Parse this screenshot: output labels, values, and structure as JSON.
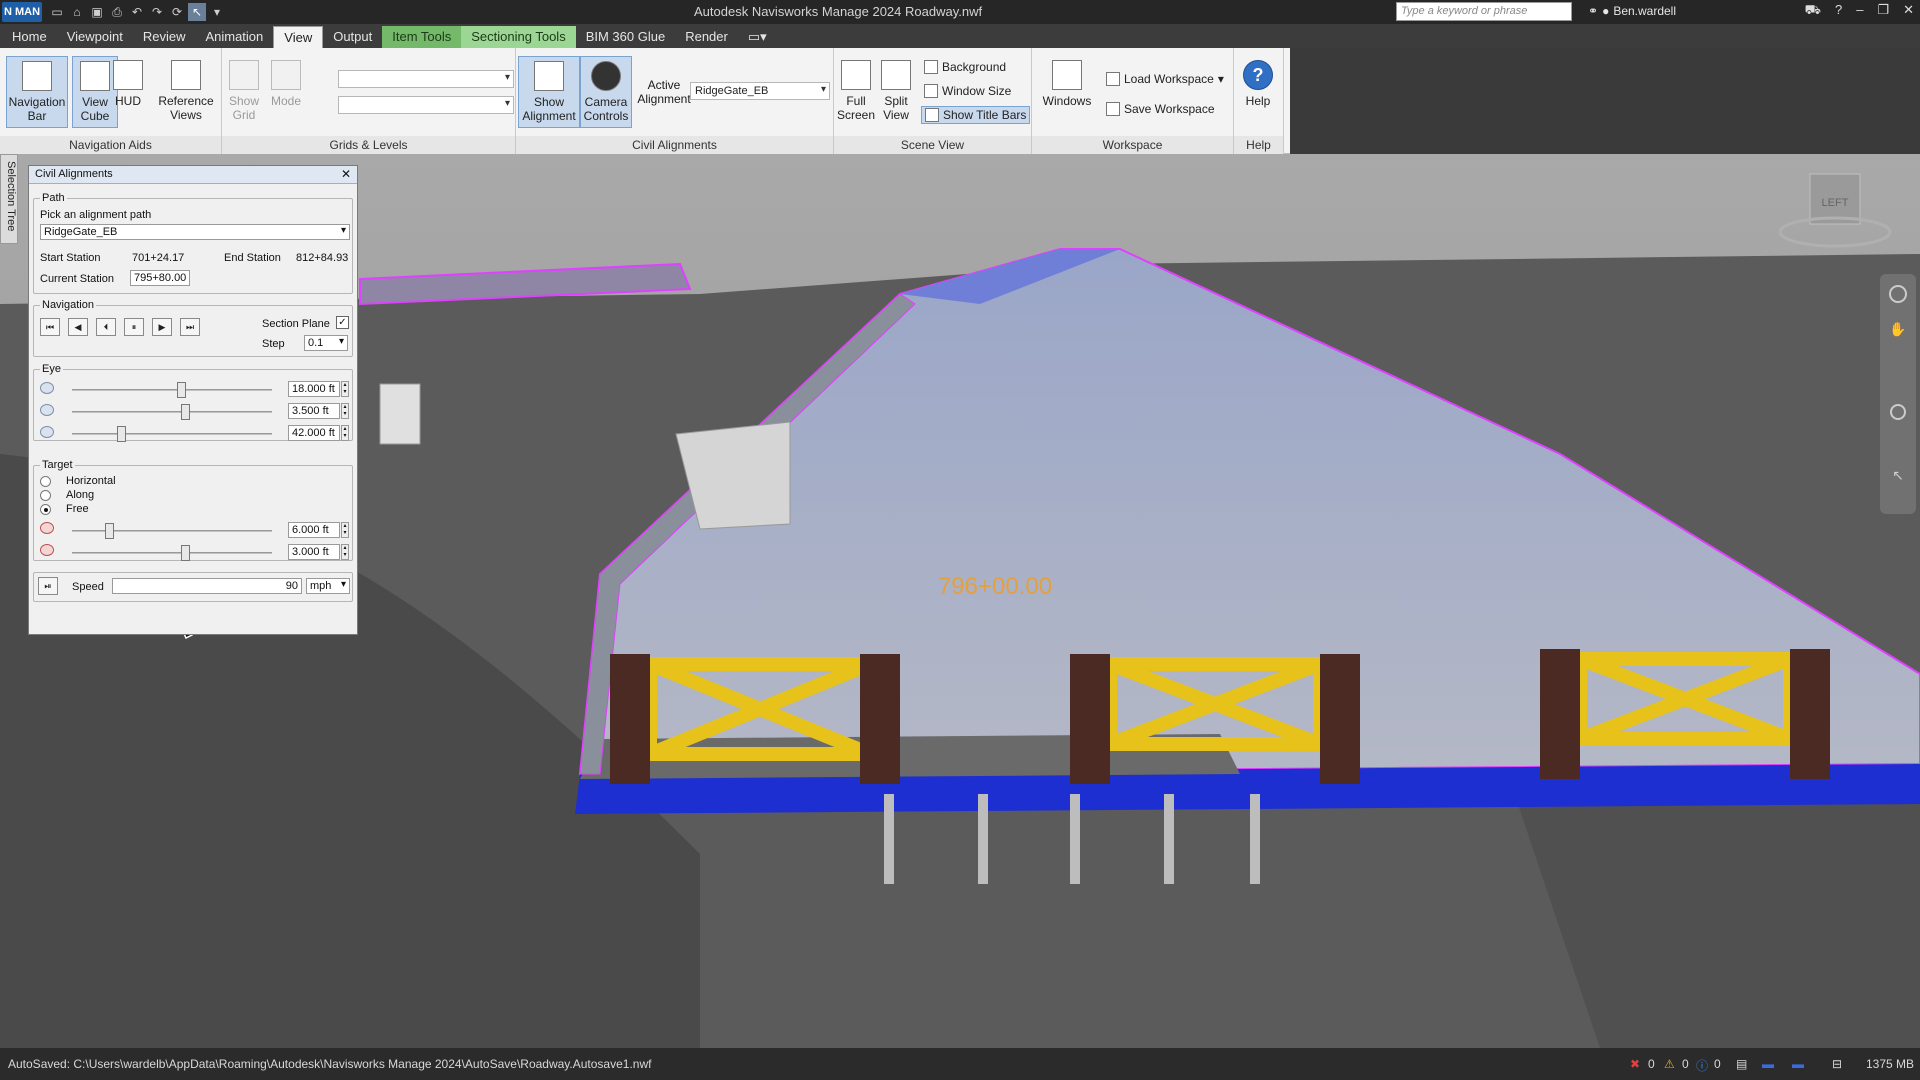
{
  "app": {
    "logo_label": "N MAN",
    "window_title": "Autodesk Navisworks Manage 2024   Roadway.nwf",
    "search_placeholder": "Type a keyword or phrase",
    "user": "Ben.wardell"
  },
  "tabs": [
    "Home",
    "Viewpoint",
    "Review",
    "Animation",
    "View",
    "Output",
    "Item Tools",
    "Sectioning Tools",
    "BIM 360 Glue",
    "Render"
  ],
  "active_tab": "View",
  "ribbon": {
    "navigation_aids": {
      "label": "Navigation Aids",
      "navigation_bar": "Navigation Bar",
      "view_cube": "View Cube",
      "hud": "HUD",
      "reference_views": "Reference Views"
    },
    "grids_levels": {
      "label": "Grids & Levels",
      "show_grid": "Show Grid",
      "mode": "Mode"
    },
    "civil_alignments": {
      "label": "Civil Alignments",
      "show_alignment": "Show Alignment",
      "camera_controls": "Camera Controls",
      "active_alignment_label": "Active Alignment",
      "active_alignment_value": "RidgeGate_EB"
    },
    "scene_view": {
      "label": "Scene View",
      "full_screen": "Full Screen",
      "split_view": "Split View",
      "background": "Background",
      "window_size": "Window Size",
      "show_title_bars": "Show Title Bars"
    },
    "workspace": {
      "label": "Workspace",
      "windows": "Windows",
      "load_workspace": "Load Workspace",
      "save_workspace": "Save Workspace"
    },
    "help": {
      "label": "Help",
      "help_button": "Help"
    }
  },
  "sidebar_tab": "Selection Tree",
  "dialog": {
    "title": "Civil Alignments",
    "path": {
      "label": "Path",
      "pick_label": "Pick an alignment path",
      "alignment": "RidgeGate_EB",
      "start_station_label": "Start Station",
      "start_station": "701+24.17",
      "end_station_label": "End Station",
      "end_station": "812+84.93",
      "current_station_label": "Current Station",
      "current_station": "795+80.00"
    },
    "navigation": {
      "label": "Navigation",
      "section_plane_label": "Section Plane",
      "step_label": "Step",
      "step": "0.1"
    },
    "eye": {
      "label": "Eye",
      "values": [
        "18.000 ft",
        "3.500 ft",
        "42.000 ft"
      ],
      "levels": [
        0.55,
        0.57,
        0.25
      ]
    },
    "target": {
      "label": "Target",
      "options": [
        "Horizontal",
        "Along",
        "Free"
      ],
      "selected": "Free",
      "values": [
        "6.000 ft",
        "3.000 ft"
      ],
      "levels": [
        0.19,
        0.57
      ]
    },
    "speed": {
      "label": "Speed",
      "value": "90",
      "unit": "mph"
    }
  },
  "viewport": {
    "station_label": "796+00.00",
    "cube_label": "LEFT"
  },
  "status": {
    "autosave": "AutoSaved: C:\\Users\\wardelb\\AppData\\Roaming\\Autodesk\\Navisworks Manage 2024\\AutoSave\\Roadway.Autosave1.nwf",
    "count1": "0",
    "count2": "0",
    "count3": "0",
    "memory": "1375 MB"
  }
}
